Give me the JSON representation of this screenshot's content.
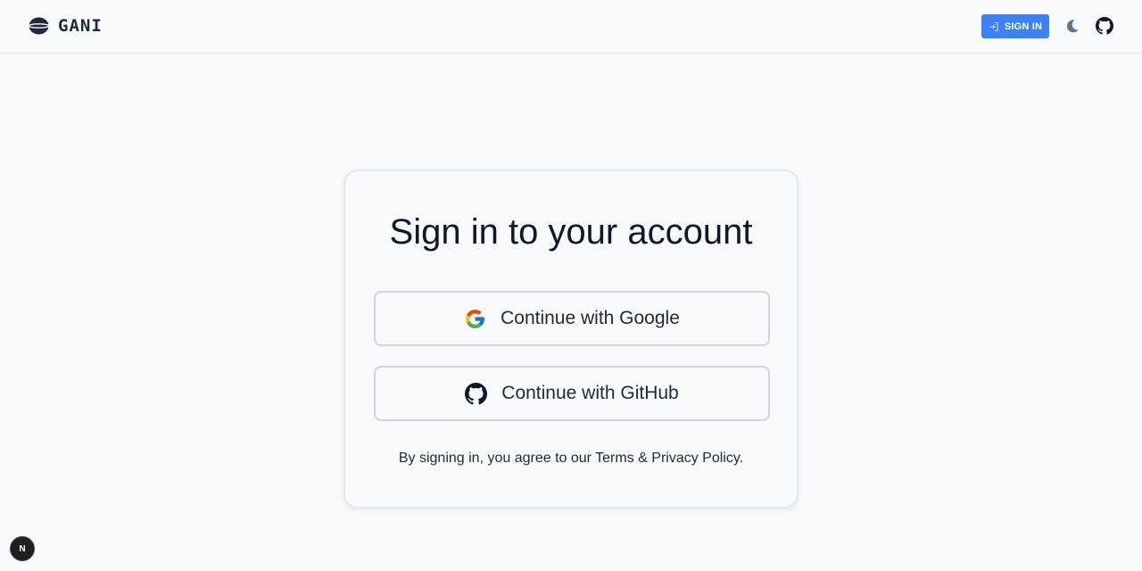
{
  "header": {
    "brand_name": "GANI",
    "signin_label": "SIGN IN",
    "accent_color": "#3b82f6"
  },
  "card": {
    "title": "Sign in to your account",
    "google_label": "Continue with Google",
    "github_label": "Continue with GitHub",
    "terms_prefix": "By signing in, you agree to our ",
    "terms_link": "Terms & Privacy Policy",
    "terms_suffix": "."
  },
  "badge": {
    "letter": "N"
  },
  "icons": [
    "planet-logo-icon",
    "sign-in-icon",
    "moon-icon",
    "github-icon",
    "google-icon"
  ]
}
